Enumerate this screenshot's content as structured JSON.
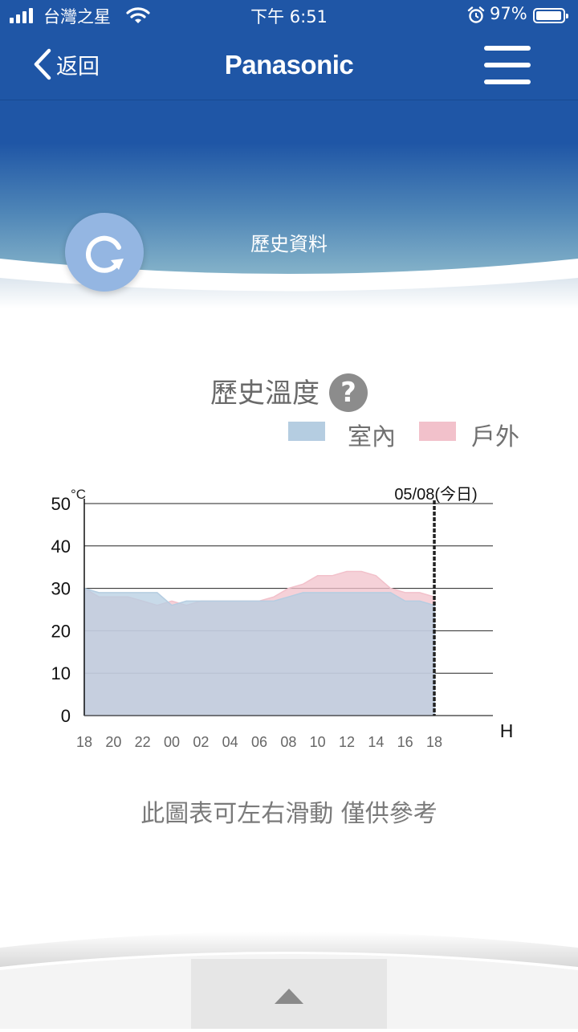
{
  "status_bar": {
    "carrier": "台灣之星",
    "time": "下午 6:51",
    "battery": "97%",
    "battery_level": 0.97
  },
  "nav": {
    "back_label": "返回",
    "brand": "Panasonic"
  },
  "section": {
    "title": "歷史資料"
  },
  "chart_heading": "歷史溫度",
  "help_symbol": "?",
  "legend": [
    {
      "label": "室內",
      "color": "#b5cde1"
    },
    {
      "label": "戶外",
      "color": "#f2c1cb"
    }
  ],
  "footnote": "此圖表可左右滑動 僅供參考",
  "icons": [
    "signal-icon",
    "wifi-icon",
    "alarm-icon",
    "battery-icon",
    "back-chevron-icon",
    "menu-icon",
    "refresh-icon",
    "help-icon",
    "chevron-up-icon"
  ],
  "chart_data": {
    "type": "area",
    "unit_label": "°C",
    "x_axis_label": "H",
    "date_marker": "05/08(今日)",
    "x_ticks": [
      "18",
      "20",
      "22",
      "00",
      "02",
      "04",
      "06",
      "08",
      "10",
      "12",
      "14",
      "16",
      "18"
    ],
    "y_ticks": [
      "50",
      "40",
      "30",
      "20",
      "10",
      "0"
    ],
    "ylim": [
      0,
      50
    ],
    "grid": true,
    "series": [
      {
        "name": "室內",
        "color": "#b5cde1",
        "x": [
          0,
          1,
          2,
          3,
          4,
          5,
          6,
          7,
          8,
          9,
          10,
          11,
          12,
          13,
          14,
          15,
          16,
          17,
          18,
          19,
          20,
          21,
          22,
          23,
          24
        ],
        "values": [
          30,
          29,
          29,
          29,
          29,
          29,
          26,
          27,
          27,
          27,
          27,
          27,
          27,
          27,
          28,
          29,
          29,
          29,
          29,
          29,
          29,
          29,
          27,
          27,
          26
        ]
      },
      {
        "name": "戶外",
        "color": "#f2c1cb",
        "x": [
          0,
          1,
          2,
          3,
          4,
          5,
          6,
          7,
          8,
          9,
          10,
          11,
          12,
          13,
          14,
          15,
          16,
          17,
          18,
          19,
          20,
          21,
          22,
          23,
          24
        ],
        "values": [
          30,
          28,
          28,
          28,
          27,
          26,
          27,
          26,
          27,
          27,
          27,
          27,
          27,
          28,
          30,
          31,
          33,
          33,
          34,
          34,
          33,
          30,
          29,
          29,
          28
        ]
      }
    ]
  }
}
